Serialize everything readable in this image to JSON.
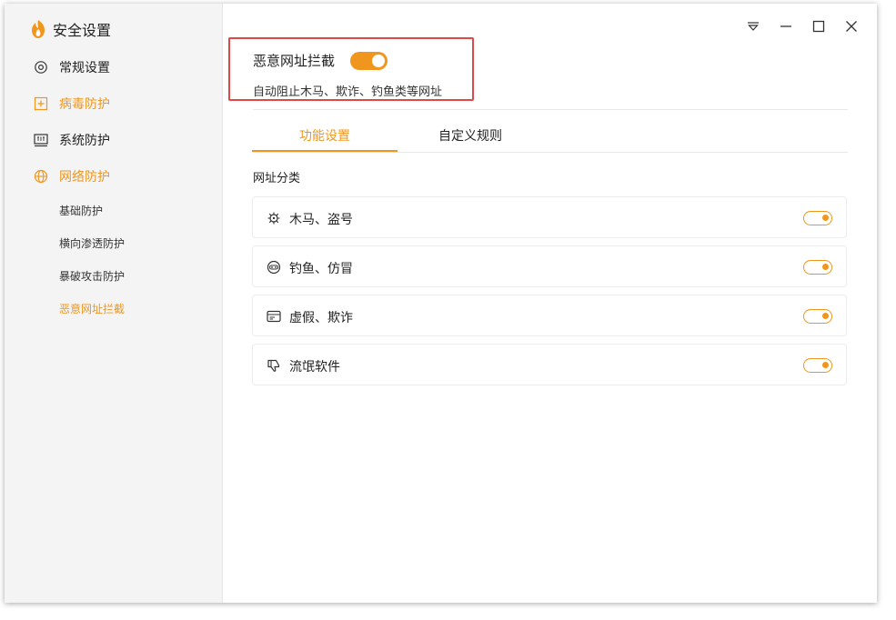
{
  "app": {
    "title": "安全设置",
    "brand_color": "#f0961e"
  },
  "sidebar": {
    "items": [
      {
        "label": "常规设置",
        "icon": "gear-icon",
        "active": false
      },
      {
        "label": "病毒防护",
        "icon": "plus-box-icon",
        "active": true
      },
      {
        "label": "系统防护",
        "icon": "system-icon",
        "active": false
      },
      {
        "label": "网络防护",
        "icon": "globe-icon",
        "active": true
      }
    ],
    "sub_items": [
      {
        "label": "基础防护",
        "active": false
      },
      {
        "label": "横向渗透防护",
        "active": false
      },
      {
        "label": "暴破攻击防护",
        "active": false
      },
      {
        "label": "恶意网址拦截",
        "active": true
      }
    ]
  },
  "window_controls": [
    "dropdown-icon",
    "minimize-icon",
    "maximize-icon",
    "close-icon"
  ],
  "feature": {
    "title": "恶意网址拦截",
    "enabled": true,
    "description": "自动阻止木马、欺诈、钓鱼类等网址"
  },
  "tabs": [
    {
      "label": "功能设置",
      "active": true
    },
    {
      "label": "自定义规则",
      "active": false
    }
  ],
  "section_label": "网址分类",
  "categories": [
    {
      "label": "木马、盗号",
      "icon": "virus-icon",
      "enabled": true
    },
    {
      "label": "钓鱼、仿冒",
      "icon": "mask-icon",
      "enabled": true
    },
    {
      "label": "虚假、欺诈",
      "icon": "card-icon",
      "enabled": true
    },
    {
      "label": "流氓软件",
      "icon": "thumb-down-icon",
      "enabled": true
    }
  ]
}
